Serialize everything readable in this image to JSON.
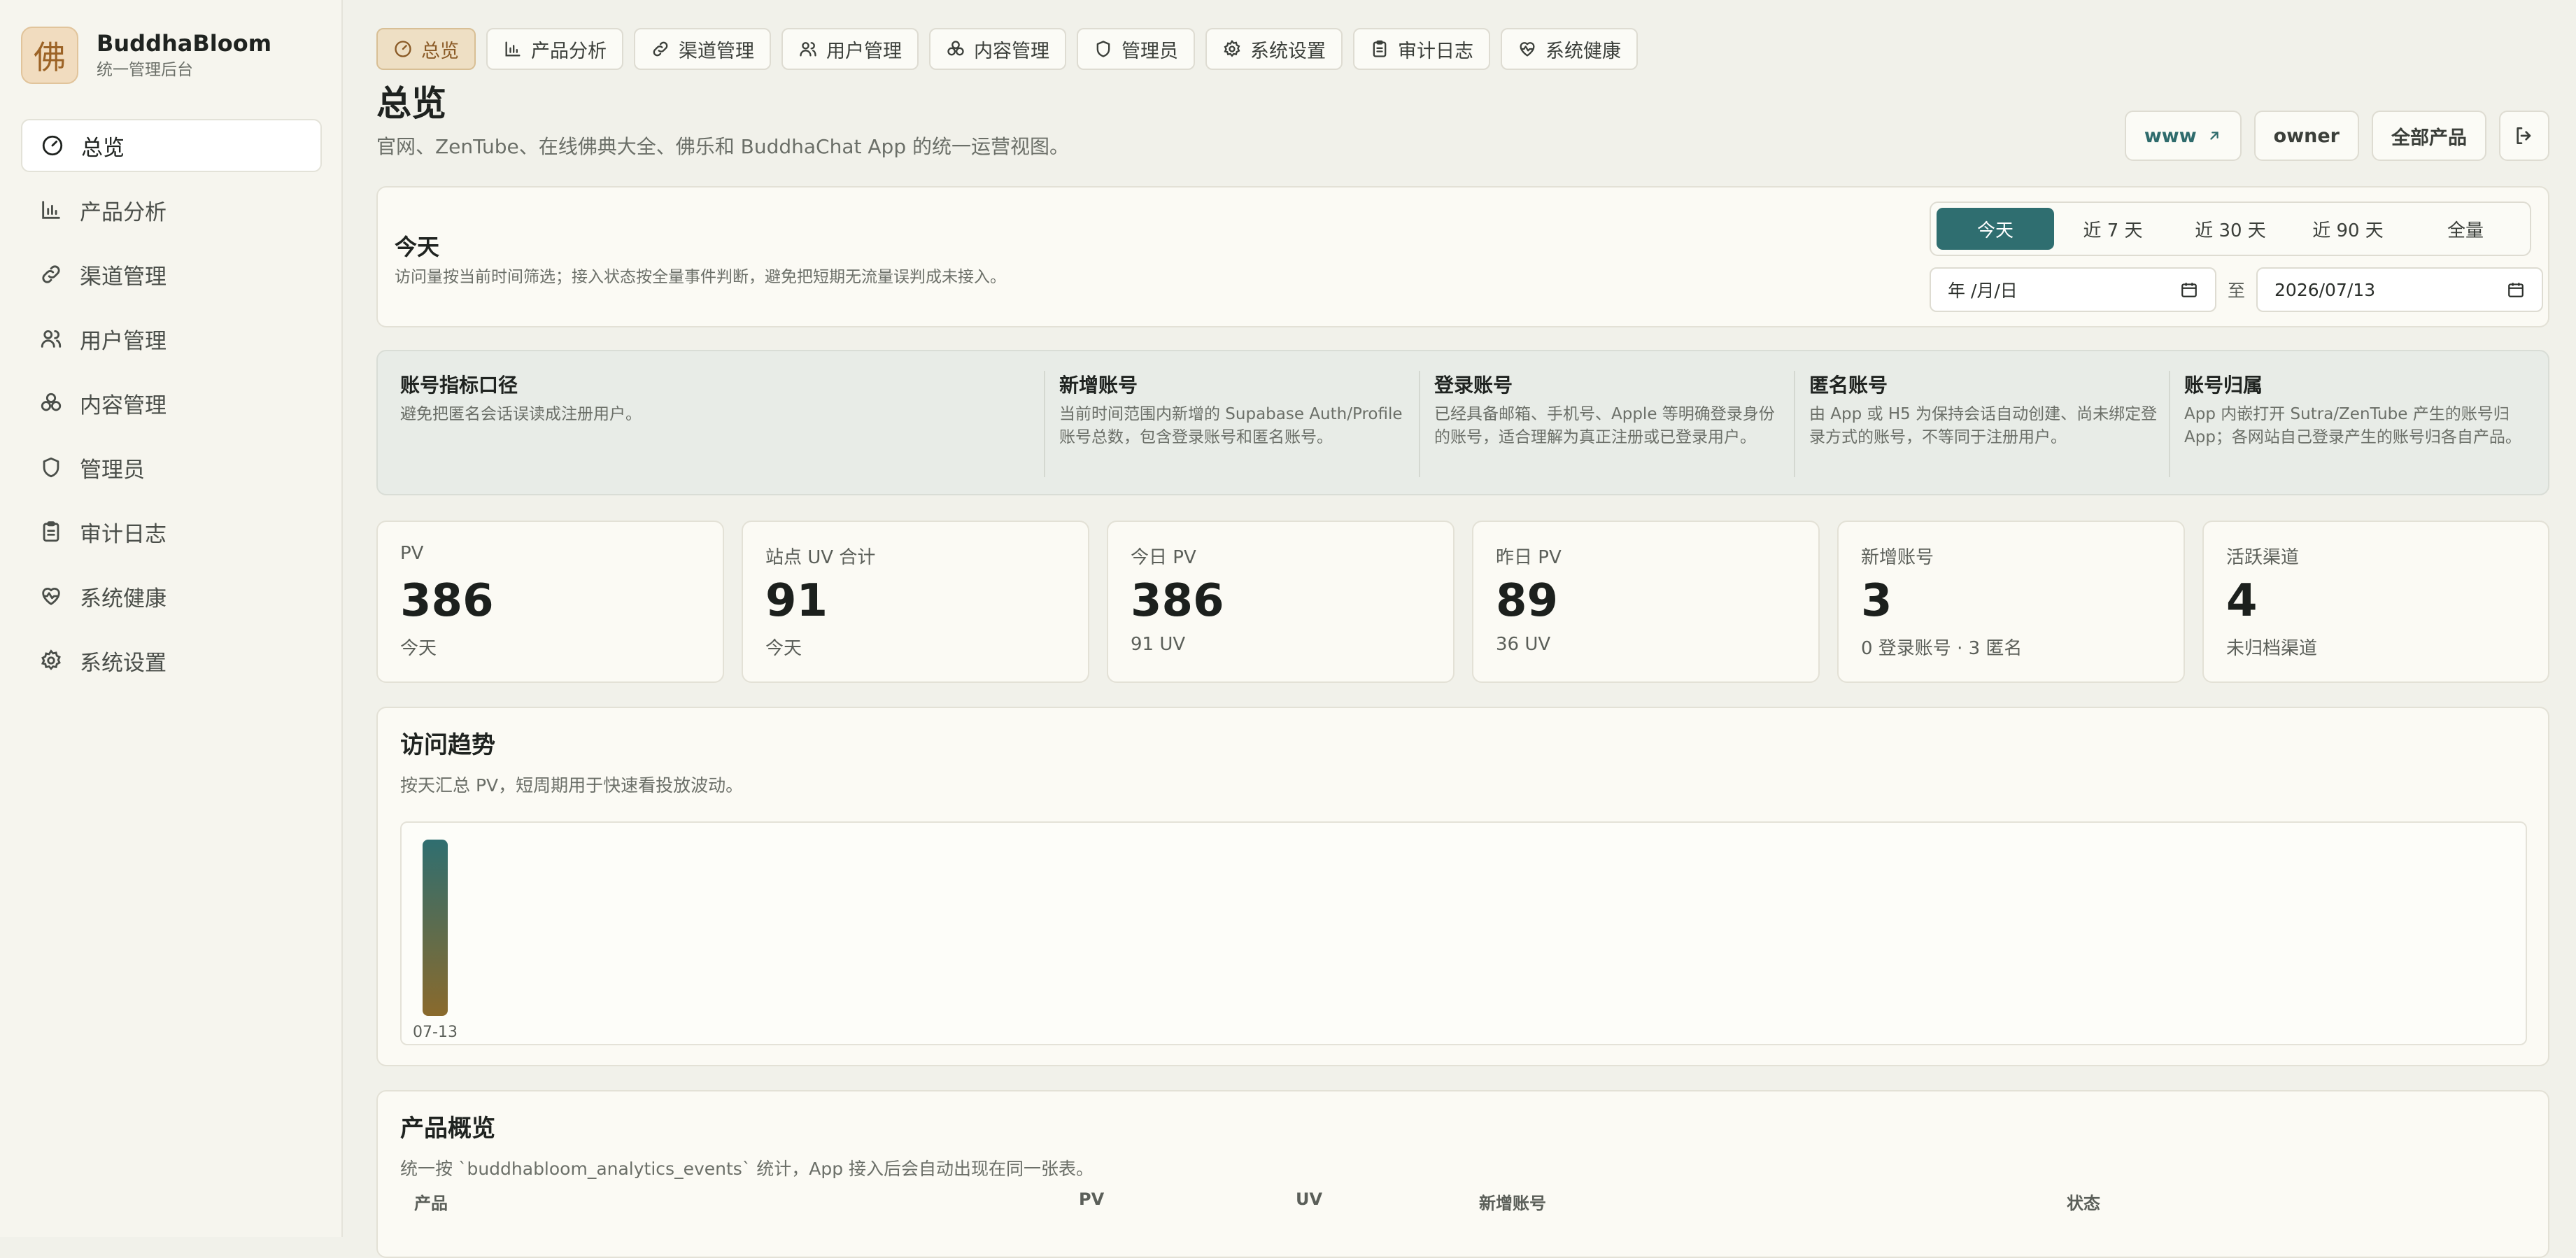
{
  "brand": {
    "logo_char": "佛",
    "name": "BuddhaBloom",
    "subtitle": "统一管理后台"
  },
  "sidebar": {
    "items": [
      {
        "label": "总览",
        "icon": "gauge-icon",
        "active": true
      },
      {
        "label": "产品分析",
        "icon": "bar-chart-icon"
      },
      {
        "label": "渠道管理",
        "icon": "link-icon"
      },
      {
        "label": "用户管理",
        "icon": "users-icon"
      },
      {
        "label": "内容管理",
        "icon": "cluster-icon"
      },
      {
        "label": "管理员",
        "icon": "shield-icon"
      },
      {
        "label": "审计日志",
        "icon": "clipboard-icon"
      },
      {
        "label": "系统健康",
        "icon": "heart-pulse-icon"
      },
      {
        "label": "系统设置",
        "icon": "gear-icon"
      }
    ]
  },
  "tabs": [
    {
      "label": "总览",
      "active": true
    },
    {
      "label": "产品分析"
    },
    {
      "label": "渠道管理"
    },
    {
      "label": "用户管理"
    },
    {
      "label": "内容管理"
    },
    {
      "label": "管理员"
    },
    {
      "label": "系统设置"
    },
    {
      "label": "审计日志"
    },
    {
      "label": "系统健康"
    }
  ],
  "header": {
    "title": "总览",
    "subtitle": "官网、ZenTube、在线佛典大全、佛乐和 BuddhaChat App 的统一运营视图。",
    "actions": {
      "site": "www",
      "role": "owner",
      "products": "全部产品"
    }
  },
  "range": {
    "title": "今天",
    "description": "访问量按当前时间筛选；接入状态按全量事件判断，避免把短期无流量误判成未接入。",
    "options": [
      "今天",
      "近 7 天",
      "近 30 天",
      "近 90 天",
      "全量"
    ],
    "selected": "今天",
    "start_date": "年 /月/日",
    "separator": "至",
    "end_date": "2026/07/13"
  },
  "metrics_info": {
    "intro": {
      "title": "账号指标口径",
      "text": "避免把匿名会话误读成注册用户。"
    },
    "cols": [
      {
        "title": "新增账号",
        "text": "当前时间范围内新增的 Supabase Auth/Profile 账号总数，包含登录账号和匿名账号。"
      },
      {
        "title": "登录账号",
        "text": "已经具备邮箱、手机号、Apple 等明确登录身份的账号，适合理解为真正注册或已登录用户。"
      },
      {
        "title": "匿名账号",
        "text": "由 App 或 H5 为保持会话自动创建、尚未绑定登录方式的账号，不等同于注册用户。"
      },
      {
        "title": "账号归属",
        "text": "App 内嵌打开 Sutra/ZenTube 产生的账号归 App；各网站自己登录产生的账号归各自产品。"
      }
    ]
  },
  "stats": [
    {
      "label": "PV",
      "value": "386",
      "sub": "今天"
    },
    {
      "label": "站点 UV 合计",
      "value": "91",
      "sub": "今天"
    },
    {
      "label": "今日 PV",
      "value": "386",
      "sub": "91 UV"
    },
    {
      "label": "昨日 PV",
      "value": "89",
      "sub": "36 UV"
    },
    {
      "label": "新增账号",
      "value": "3",
      "sub": "0 登录账号 · 3 匿名"
    },
    {
      "label": "活跃渠道",
      "value": "4",
      "sub": "未归档渠道"
    }
  ],
  "trend": {
    "title": "访问趋势",
    "description": "按天汇总 PV，短周期用于快速看投放波动。"
  },
  "chart_data": {
    "type": "bar",
    "categories": [
      "07-13"
    ],
    "values": [
      386
    ],
    "title": "",
    "xlabel": "",
    "ylabel": "",
    "ylim": [
      0,
      386
    ],
    "grid": false,
    "colors": {
      "bar_top": "#2f6e70",
      "bar_bottom": "#8a6a2c"
    }
  },
  "products": {
    "title": "产品概览",
    "description": "统一按 `buddhabloom_analytics_events` 统计，App 接入后会自动出现在同一张表。",
    "columns": [
      "产品",
      "PV",
      "UV",
      "新增账号",
      "状态"
    ]
  }
}
